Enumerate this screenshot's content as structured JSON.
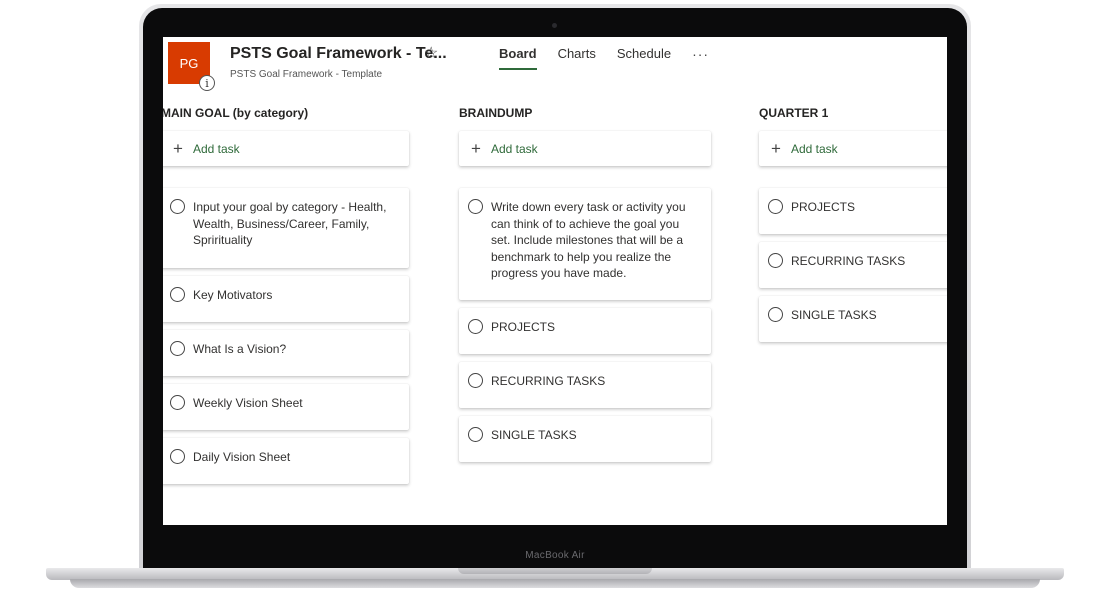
{
  "device": {
    "model_label": "MacBook Air"
  },
  "plan": {
    "avatar_initials": "PG",
    "title": "PSTS Goal Framework - Te...",
    "subtitle": "PSTS Goal Framework - Template",
    "info_glyph": "i",
    "star_glyph": "☆"
  },
  "tabs": [
    {
      "label": "Board",
      "active": true
    },
    {
      "label": "Charts",
      "active": false
    },
    {
      "label": "Schedule",
      "active": false
    }
  ],
  "more_glyph": "···",
  "add_task_label": "Add task",
  "add_glyph": "+",
  "columns": [
    {
      "title": "MAIN GOAL (by category)",
      "tasks": [
        "Input your goal by category - Health, Wealth, Business/Career, Family, Sprirituality",
        "Key Motivators",
        "What Is a Vision?",
        "Weekly Vision Sheet",
        "Daily Vision Sheet"
      ]
    },
    {
      "title": "BRAINDUMP",
      "tasks": [
        "Write down every task or activity you can think of to achieve the goal you set. Include milestones that will be a benchmark to help you realize the progress you have made.",
        "PROJECTS",
        "RECURRING TASKS",
        "SINGLE TASKS"
      ]
    },
    {
      "title": "QUARTER 1",
      "tasks": [
        "PROJECTS",
        "RECURRING TASKS",
        "SINGLE TASKS"
      ]
    }
  ],
  "colors": {
    "avatar_bg": "#d83b01",
    "accent_green": "#2f6a3a"
  }
}
